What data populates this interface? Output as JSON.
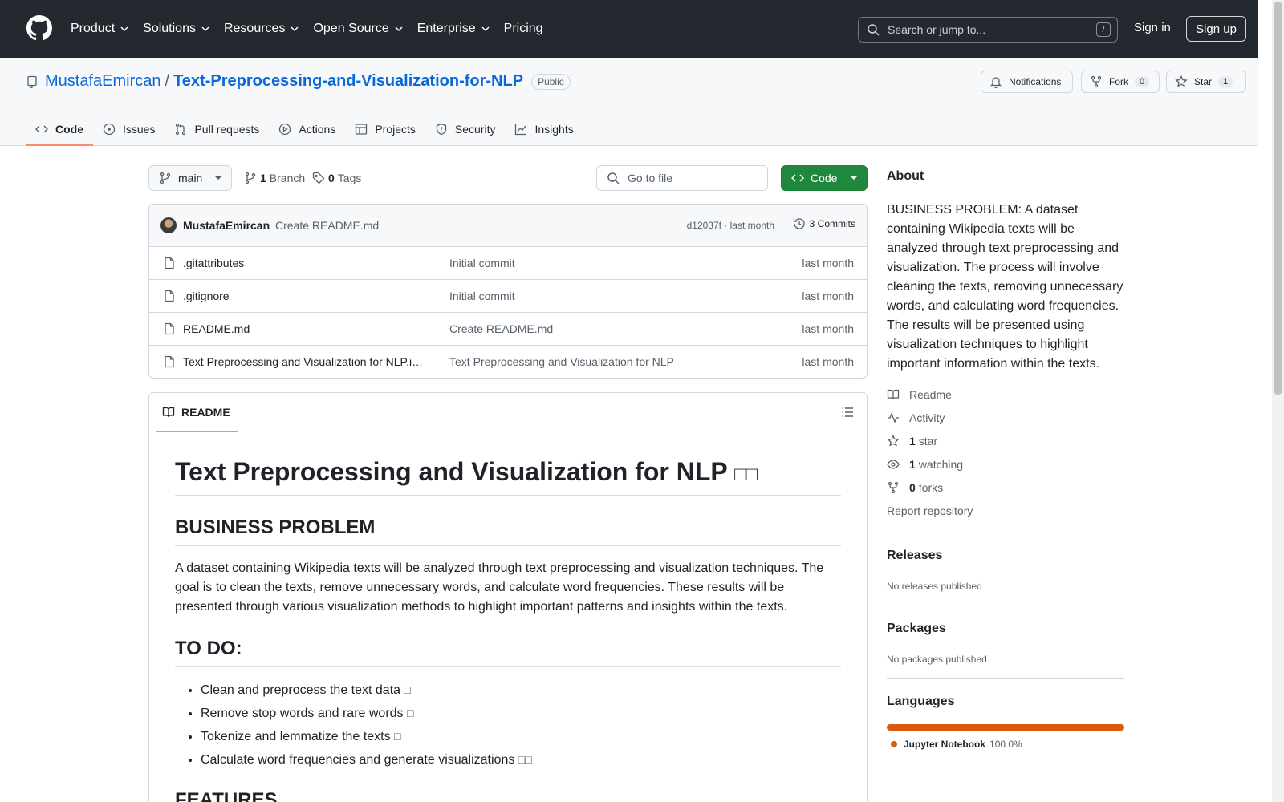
{
  "header": {
    "nav": [
      "Product",
      "Solutions",
      "Resources",
      "Open Source",
      "Enterprise",
      "Pricing"
    ],
    "search_placeholder": "Search or jump to...",
    "search_key": "/",
    "sign_in": "Sign in",
    "sign_up": "Sign up"
  },
  "repo": {
    "owner": "MustafaEmircan",
    "separator": "/",
    "name": "Text-Preprocessing-and-Visualization-for-NLP",
    "visibility": "Public",
    "notifications": "Notifications",
    "fork_label": "Fork",
    "fork_count": "0",
    "star_label": "Star",
    "star_count": "1"
  },
  "tabs": [
    "Code",
    "Issues",
    "Pull requests",
    "Actions",
    "Projects",
    "Security",
    "Insights"
  ],
  "toolbar": {
    "branch": "main",
    "branch_count": "1",
    "branch_label": "Branch",
    "tag_count": "0",
    "tag_label": "Tags",
    "goto_placeholder": "Go to file",
    "code_label": "Code"
  },
  "commit": {
    "author": "MustafaEmircan",
    "message": "Create README.md",
    "meta": "d12037f · last month",
    "commits": "3 Commits"
  },
  "files": [
    {
      "name": ".gitattributes",
      "message": "Initial commit",
      "time": "last month"
    },
    {
      "name": ".gitignore",
      "message": "Initial commit",
      "time": "last month"
    },
    {
      "name": "README.md",
      "message": "Create README.md",
      "time": "last month"
    },
    {
      "name": "Text Preprocessing and Visualization for NLP.ipynb",
      "message": "Text Preprocessing and Visualization for NLP",
      "time": "last month"
    }
  ],
  "readme": {
    "tab_label": "README",
    "title": "Text Preprocessing and Visualization for NLP",
    "title_glyphs": "□□",
    "h2_problem": "BUSINESS PROBLEM",
    "problem_text": "A dataset containing Wikipedia texts will be analyzed through text preprocessing and visualization techniques. The goal is to clean the texts, remove unnecessary words, and calculate word frequencies. These results will be presented through various visualization methods to highlight important patterns and insights within the texts.",
    "h2_todo": "TO DO:",
    "todo": [
      {
        "text": "Clean and preprocess the text data",
        "glyph": "□"
      },
      {
        "text": "Remove stop words and rare words",
        "glyph": "□"
      },
      {
        "text": "Tokenize and lemmatize the texts",
        "glyph": "□"
      },
      {
        "text": "Calculate word frequencies and generate visualizations",
        "glyph": "□□"
      }
    ],
    "h2_features": "FEATURES"
  },
  "about": {
    "title": "About",
    "description": "BUSINESS PROBLEM: A dataset containing Wikipedia texts will be analyzed through text preprocessing and visualization. The process will involve cleaning the texts, removing unnecessary words, and calculating word frequencies. The results will be presented using visualization techniques to highlight important information within the texts.",
    "readme": "Readme",
    "activity": "Activity",
    "stars_count": "1",
    "stars_label": "star",
    "watching_count": "1",
    "watching_label": "watching",
    "forks_count": "0",
    "forks_label": "forks",
    "report": "Report repository"
  },
  "releases": {
    "title": "Releases",
    "empty": "No releases published"
  },
  "packages": {
    "title": "Packages",
    "empty": "No packages published"
  },
  "languages": {
    "title": "Languages",
    "items": [
      {
        "name": "Jupyter Notebook",
        "percent": "100.0%",
        "color": "#da5b0b"
      }
    ]
  }
}
